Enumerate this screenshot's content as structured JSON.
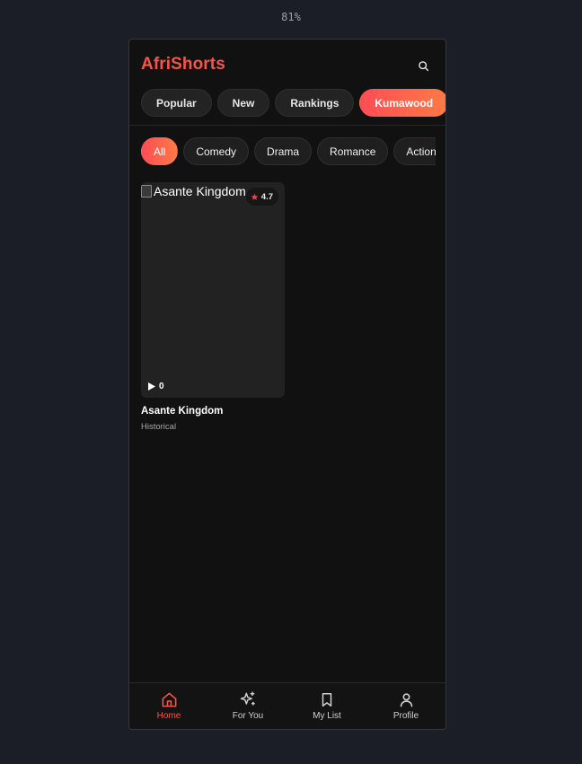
{
  "zoom_label": "81%",
  "app": {
    "title": "AfriShorts",
    "brand_color": "#f4554a"
  },
  "search": {
    "icon": "search-icon"
  },
  "tabs": [
    {
      "label": "Popular",
      "active": false
    },
    {
      "label": "New",
      "active": false
    },
    {
      "label": "Rankings",
      "active": false
    },
    {
      "label": "Kumawood",
      "active": true
    }
  ],
  "genres": [
    {
      "label": "All",
      "active": true
    },
    {
      "label": "Comedy",
      "active": false
    },
    {
      "label": "Drama",
      "active": false
    },
    {
      "label": "Romance",
      "active": false
    },
    {
      "label": "Action",
      "active": false
    }
  ],
  "cards": [
    {
      "title": "Asante Kingdom",
      "image_alt": "Asante Kingdom",
      "rating": "4.7",
      "plays": "0",
      "category": "Historical"
    }
  ],
  "bottom_nav": [
    {
      "label": "Home",
      "icon": "home-icon",
      "active": true
    },
    {
      "label": "For You",
      "icon": "sparkles-icon",
      "active": false
    },
    {
      "label": "My List",
      "icon": "bookmark-icon",
      "active": false
    },
    {
      "label": "Profile",
      "icon": "user-icon",
      "active": false
    }
  ],
  "colors": {
    "accent_gradient_start": "#ff4d55",
    "accent_gradient_end": "#ff7a45",
    "rating_star": "#ff3b4a",
    "background": "#111111"
  }
}
